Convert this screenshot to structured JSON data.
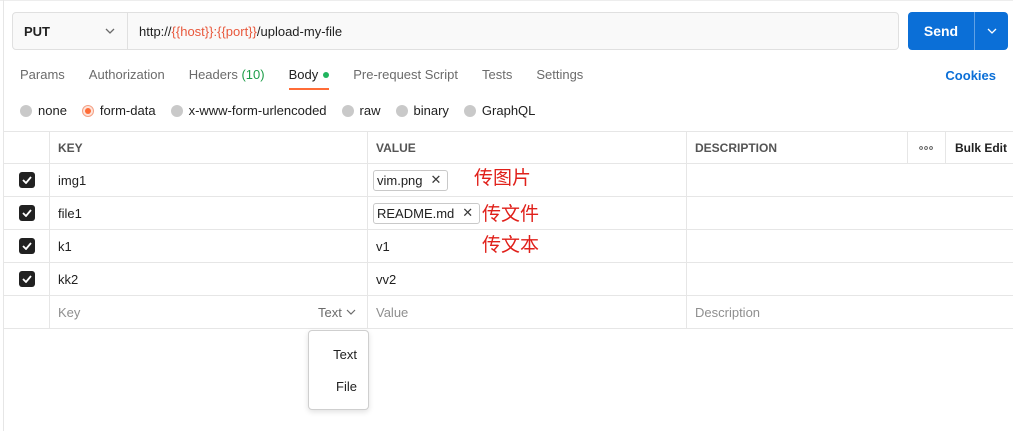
{
  "request": {
    "method": "PUT",
    "url_prefix": "http://",
    "url_var_host": "{{host}}",
    "url_colon": ":",
    "url_var_port": "{{port}}",
    "url_path": "/upload-my-file",
    "send_label": "Send"
  },
  "tabs": [
    {
      "label": "Params"
    },
    {
      "label": "Authorization"
    },
    {
      "label": "Headers",
      "count": "(10)"
    },
    {
      "label": "Body",
      "active": true
    },
    {
      "label": "Pre-request Script"
    },
    {
      "label": "Tests"
    },
    {
      "label": "Settings"
    }
  ],
  "cookies_label": "Cookies",
  "body_types": [
    {
      "label": "none"
    },
    {
      "label": "form-data",
      "selected": true
    },
    {
      "label": "x-www-form-urlencoded"
    },
    {
      "label": "raw"
    },
    {
      "label": "binary"
    },
    {
      "label": "GraphQL"
    }
  ],
  "table": {
    "headers": {
      "key": "KEY",
      "value": "VALUE",
      "description": "DESCRIPTION",
      "more": "ooo",
      "bulk_edit": "Bulk Edit"
    },
    "rows": [
      {
        "key": "img1",
        "value": "vim.png",
        "is_file": true,
        "checked": true,
        "note": "传图片"
      },
      {
        "key": "file1",
        "value": "README.md",
        "is_file": true,
        "checked": true,
        "note": "传文件"
      },
      {
        "key": "k1",
        "value": "v1",
        "is_file": false,
        "checked": true,
        "note": "传文本"
      },
      {
        "key": "kk2",
        "value": "vv2",
        "is_file": false,
        "checked": true
      }
    ],
    "new_row": {
      "key_placeholder": "Key",
      "type_label": "Text",
      "value_placeholder": "Value",
      "description_placeholder": "Description"
    }
  },
  "type_menu": {
    "options": [
      "Text",
      "File"
    ]
  },
  "colors": {
    "accent_orange": "#FF6C37",
    "send_blue": "#0B6FD7",
    "annotation_red": "#E0201A",
    "variable_orange": "#E8583C"
  }
}
